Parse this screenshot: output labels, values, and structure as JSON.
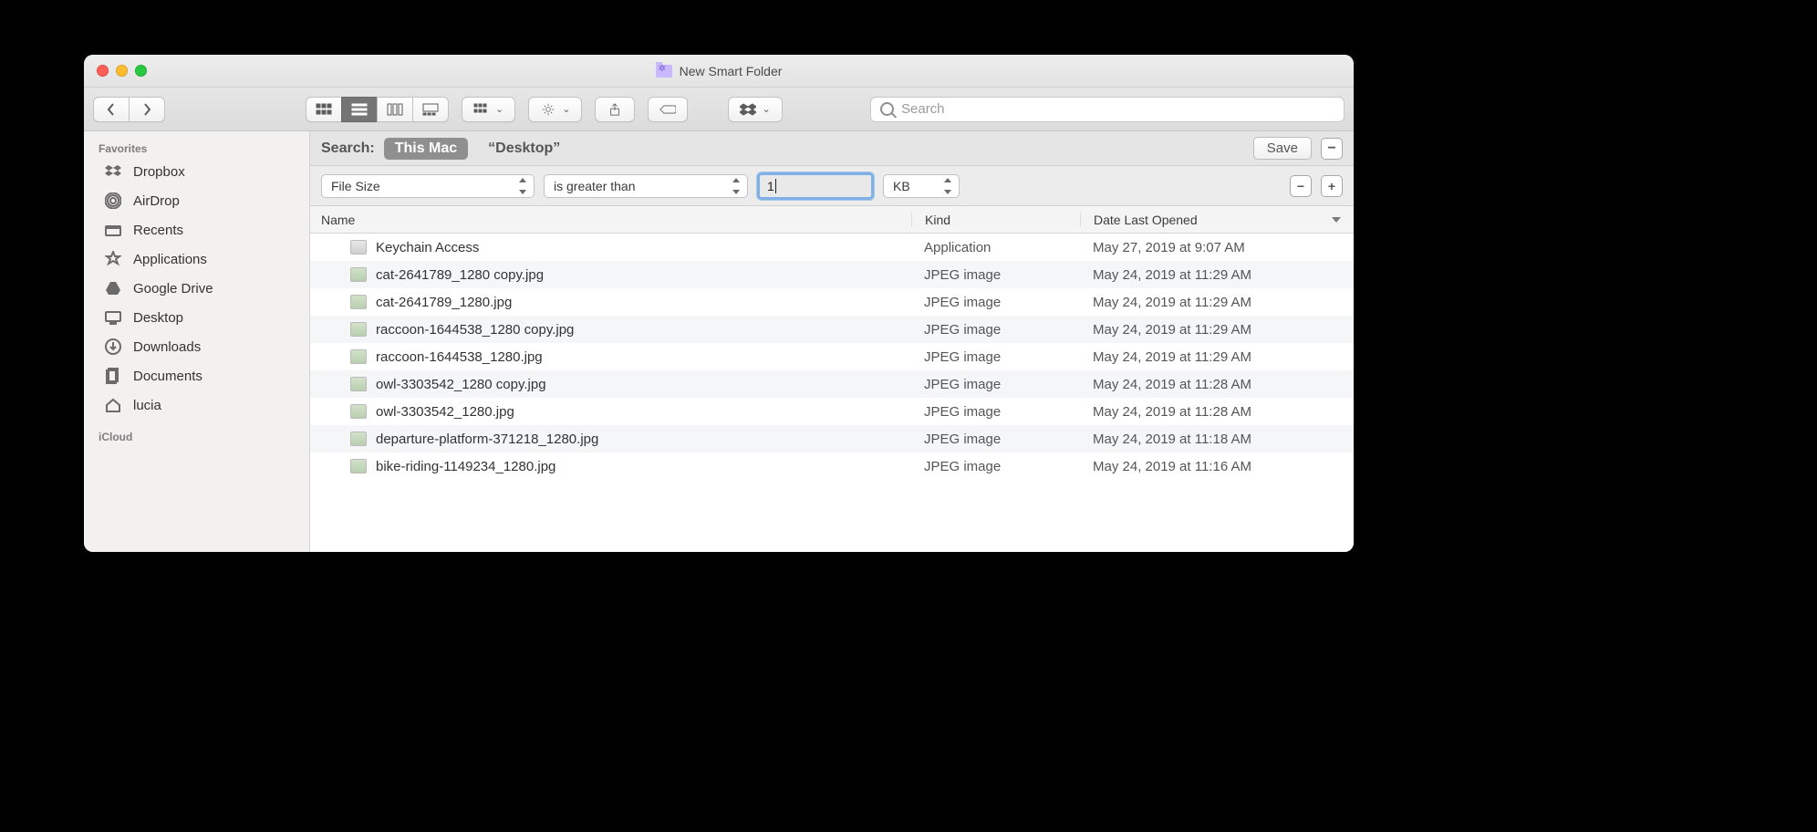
{
  "window": {
    "title": "New Smart Folder"
  },
  "search": {
    "placeholder": "Search"
  },
  "sidebar": {
    "favorites_label": "Favorites",
    "icloud_label": "iCloud",
    "items": [
      {
        "label": "Dropbox",
        "icon": "dropbox-icon"
      },
      {
        "label": "AirDrop",
        "icon": "airdrop-icon"
      },
      {
        "label": "Recents",
        "icon": "recents-icon"
      },
      {
        "label": "Applications",
        "icon": "applications-icon"
      },
      {
        "label": "Google Drive",
        "icon": "gdrive-icon"
      },
      {
        "label": "Desktop",
        "icon": "desktop-icon"
      },
      {
        "label": "Downloads",
        "icon": "downloads-icon"
      },
      {
        "label": "Documents",
        "icon": "documents-icon"
      },
      {
        "label": "lucia",
        "icon": "home-icon"
      }
    ]
  },
  "scope": {
    "label": "Search:",
    "this_mac": "This Mac",
    "desktop": "“Desktop”",
    "save": "Save"
  },
  "criteria": {
    "attribute": "File Size",
    "operator": "is greater than",
    "value": "1",
    "unit": "KB"
  },
  "columns": {
    "name": "Name",
    "kind": "Kind",
    "date": "Date Last Opened"
  },
  "files": [
    {
      "name": "Keychain Access",
      "kind": "Application",
      "date": "May 27, 2019 at 9:07 AM",
      "ico": "app"
    },
    {
      "name": "cat-2641789_1280 copy.jpg",
      "kind": "JPEG image",
      "date": "May 24, 2019 at 11:29 AM",
      "ico": "jpg"
    },
    {
      "name": "cat-2641789_1280.jpg",
      "kind": "JPEG image",
      "date": "May 24, 2019 at 11:29 AM",
      "ico": "jpg"
    },
    {
      "name": "raccoon-1644538_1280 copy.jpg",
      "kind": "JPEG image",
      "date": "May 24, 2019 at 11:29 AM",
      "ico": "jpg"
    },
    {
      "name": "raccoon-1644538_1280.jpg",
      "kind": "JPEG image",
      "date": "May 24, 2019 at 11:29 AM",
      "ico": "jpg"
    },
    {
      "name": "owl-3303542_1280 copy.jpg",
      "kind": "JPEG image",
      "date": "May 24, 2019 at 11:28 AM",
      "ico": "jpg"
    },
    {
      "name": "owl-3303542_1280.jpg",
      "kind": "JPEG image",
      "date": "May 24, 2019 at 11:28 AM",
      "ico": "jpg"
    },
    {
      "name": "departure-platform-371218_1280.jpg",
      "kind": "JPEG image",
      "date": "May 24, 2019 at 11:18 AM",
      "ico": "jpg"
    },
    {
      "name": "bike-riding-1149234_1280.jpg",
      "kind": "JPEG image",
      "date": "May 24, 2019 at 11:16 AM",
      "ico": "jpg"
    }
  ]
}
